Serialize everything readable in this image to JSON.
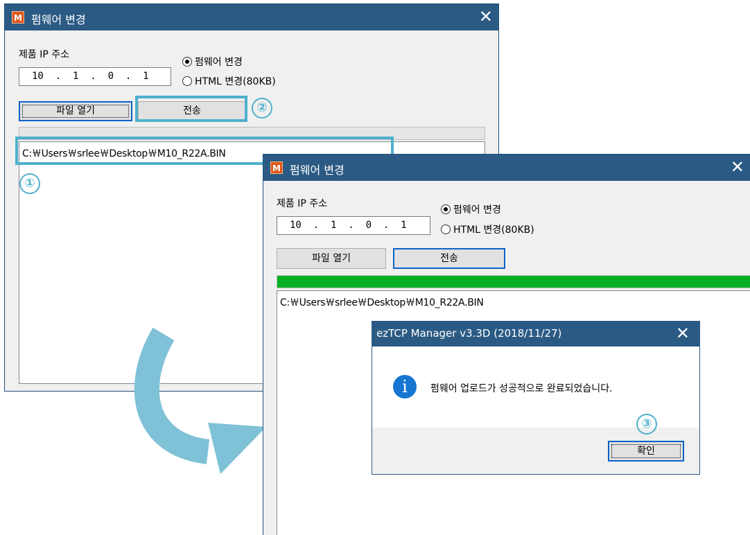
{
  "window1": {
    "app_icon": "M",
    "title": "펌웨어 변경",
    "close": "✕",
    "ip_label": "제품 IP 주소",
    "ip_value": "10  .  1  .  0  .  1",
    "radio_firmware": "펌웨어 변경",
    "radio_html": "HTML 변경(80KB)",
    "open_button": "파일 열기",
    "send_button": "전송",
    "progress": 0,
    "file_path": "C:￦Users￦srlee￦Desktop￦M10_R22A.BIN"
  },
  "window2": {
    "app_icon": "M",
    "title": "펌웨어 변경",
    "close": "✕",
    "ip_label": "제품 IP 주소",
    "ip_value": "10  .  1  .  0  .  1",
    "radio_firmware": "펌웨어 변경",
    "radio_html": "HTML 변경(80KB)",
    "open_button": "파일 열기",
    "send_button": "전송",
    "progress": 1.0,
    "file_path": "C:￦Users￦srlee￦Desktop￦M10_R22A.BIN"
  },
  "dialog": {
    "title": "ezTCP Manager v3.3D (2018/11/27)",
    "close": "✕",
    "icon": "info-icon",
    "message": "펌웨어 업로드가 성공적으로 완료되었습니다.",
    "ok_button": "확인"
  },
  "annotations": {
    "step1": "①",
    "step2": "②",
    "step3": "③"
  },
  "colors": {
    "titlebar": "#2b5a84",
    "highlight": "#4fb0cc",
    "progress": "#06b025",
    "info": "#1676d2"
  }
}
